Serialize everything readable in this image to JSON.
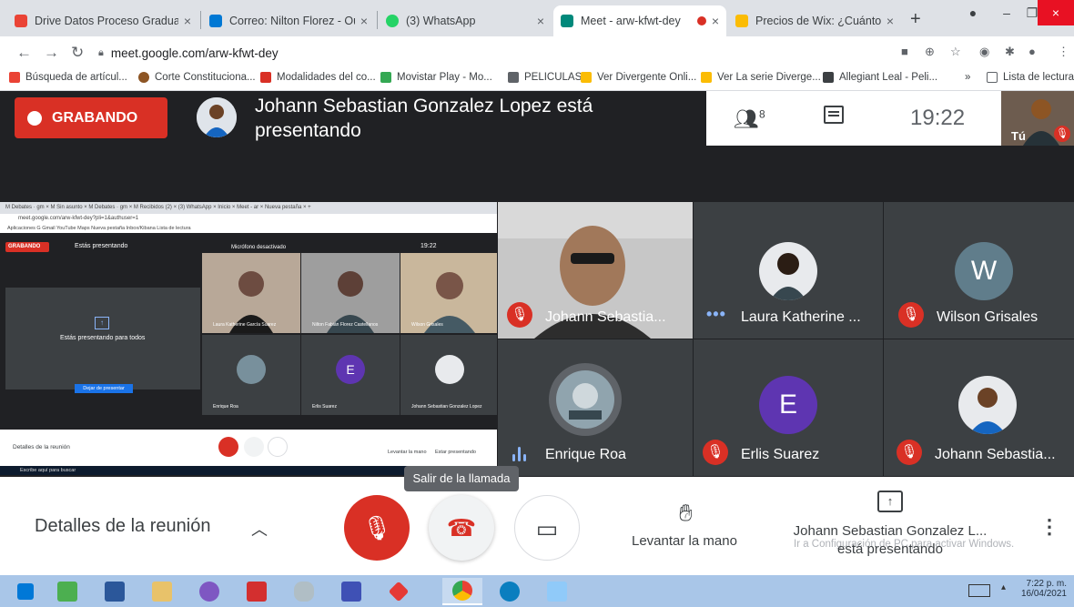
{
  "browser": {
    "tabs": [
      {
        "label": "Drive Datos Proceso Graduand",
        "color": "#ea4335"
      },
      {
        "label": "Correo: Nilton Florez - Outlook",
        "color": "#0078d4"
      },
      {
        "label": "(3) WhatsApp",
        "color": "#25d366"
      },
      {
        "label": "Meet - arw-kfwt-dey",
        "color": "#00897b"
      },
      {
        "label": "Precios de Wix: ¿Cuánto pagar",
        "color": "#fbbc04"
      }
    ],
    "url": "meet.google.com/arw-kfwt-dey",
    "bookmarks": [
      {
        "label": "Búsqueda de artícul...",
        "color": "#d93025"
      },
      {
        "label": "Corte Constituciona...",
        "color": "#8d5524"
      },
      {
        "label": "Modalidades del co...",
        "color": "#d93025"
      },
      {
        "label": "Movistar Play - Mo...",
        "color": "#34a853"
      },
      {
        "label": "PELICULAS",
        "color": "#5f6368"
      },
      {
        "label": "Ver Divergente Onli...",
        "color": "#fbbc04"
      },
      {
        "label": "Ver La serie Diverge...",
        "color": "#fbbc04"
      },
      {
        "label": "Allegiant Leal - Peli...",
        "color": "#3c4043"
      },
      {
        "label": "Lista de lectura",
        "color": "#5f6368"
      }
    ]
  },
  "meet": {
    "recording_label": "GRABANDO",
    "presenting_title": "Johann Sebastian Gonzalez Lopez está presentando",
    "participant_count": "8",
    "clock": "19:22",
    "self_label": "Tú",
    "participants": [
      {
        "name": "Johann Sebastia...",
        "status": "muted"
      },
      {
        "name": "Laura Katherine ...",
        "status": "dots"
      },
      {
        "name": "Wilson Grisales",
        "status": "muted",
        "letter": "W",
        "avatar_color": "#607d8b"
      },
      {
        "name": "Enrique Roa",
        "status": "speaking"
      },
      {
        "name": "Erlis Suarez",
        "status": "muted",
        "letter": "E",
        "avatar_color": "#5e35b1"
      },
      {
        "name": "Johann Sebastia...",
        "status": "muted"
      }
    ],
    "shared_screen": {
      "tabs_text": "M Debates · gm  ×  M Sin asunto ×  M Debates · gm ×  M Recibidos (2) ×  (3) WhatsApp ×  Inicio  ×  Meet - ar  ×  Nueva pestaña  ×  +",
      "address_text": "meet.google.com/arw-kfwt-dey?pli=1&authuser=1",
      "bookmarks_text": "Aplicaciones   G Gmail   YouTube   Maps   Nueva pestaña   Inbox/Kibana         Lista de lectura",
      "recording_label": "GRABANDO",
      "you_presenting": "Estás presentando",
      "mic_off": "Micrófono desactivado",
      "clock": "19:22",
      "presenting_to_all": "Estás presentando para todos",
      "stop_presenting": "Dejar de presentar",
      "tiles": [
        {
          "name": "Laura Katherine García Suarez"
        },
        {
          "name": "Nilton Fabián Florez Castellanos"
        },
        {
          "name": "Wilson Grisales"
        },
        {
          "name": "Enrique Roa"
        },
        {
          "name": "Erlis Suarez"
        },
        {
          "name": "Johann Sebastian Gonzalez Lopez"
        }
      ],
      "meeting_details": "Detalles de la reunión",
      "raise_hand": "Levantar la mano",
      "now_presenting": "Estar presentando",
      "taskbar_text": "Escribe aquí para buscar"
    },
    "bottom": {
      "meeting_details": "Detalles de la reunión",
      "tooltip": "Salir de la llamada",
      "raise_hand": "Levantar la mano",
      "presenting_line1": "Johann Sebastian Gonzalez L...",
      "presenting_line2": "está presentando",
      "activate_windows": "Ir a Configuración de PC para activar Windows."
    },
    "colors": {
      "record_red": "#d93025",
      "tile_bg": "#3c4043",
      "meet_bg": "#202124",
      "accent_blue": "#8ab4f8"
    }
  },
  "taskbar": {
    "time": "7:22 p. m.",
    "date": "16/04/2021"
  }
}
